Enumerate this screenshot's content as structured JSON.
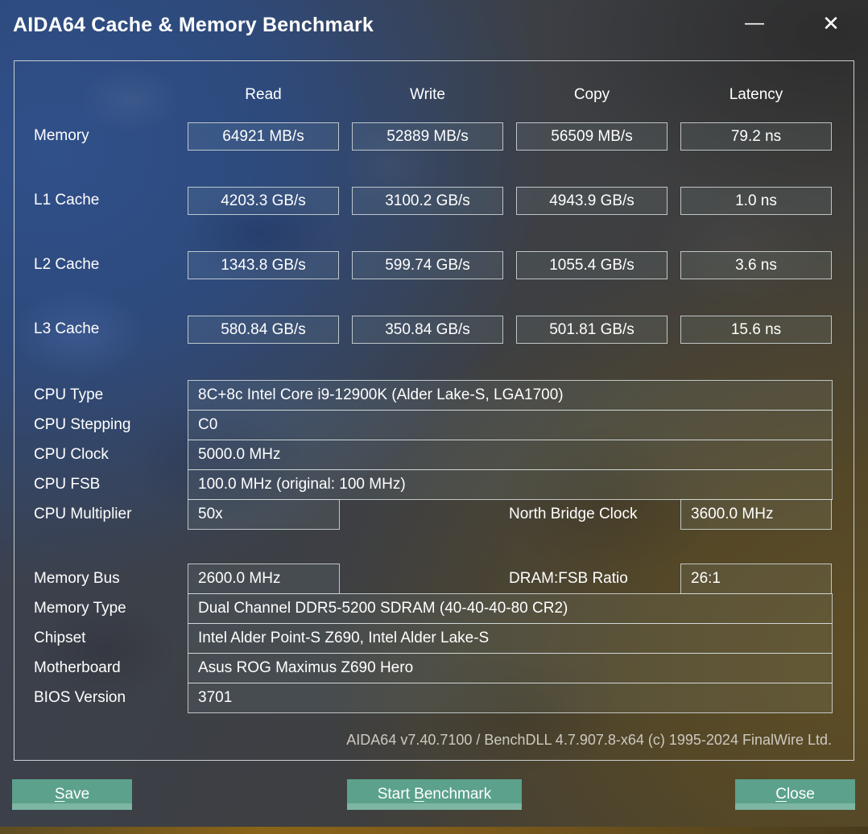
{
  "window": {
    "title": "AIDA64 Cache & Memory Benchmark",
    "minimize_icon": "—",
    "close_icon": "✕"
  },
  "benchmark": {
    "columns": [
      "Read",
      "Write",
      "Copy",
      "Latency"
    ],
    "rows": [
      {
        "label": "Memory",
        "values": [
          "64921 MB/s",
          "52889 MB/s",
          "56509 MB/s",
          "79.2 ns"
        ]
      },
      {
        "label": "L1 Cache",
        "values": [
          "4203.3 GB/s",
          "3100.2 GB/s",
          "4943.9 GB/s",
          "1.0 ns"
        ]
      },
      {
        "label": "L2 Cache",
        "values": [
          "1343.8 GB/s",
          "599.74 GB/s",
          "1055.4 GB/s",
          "3.6 ns"
        ]
      },
      {
        "label": "L3 Cache",
        "values": [
          "580.84 GB/s",
          "350.84 GB/s",
          "501.81 GB/s",
          "15.6 ns"
        ]
      }
    ]
  },
  "cpu": {
    "stack": [
      {
        "label": "CPU Type",
        "value": "8C+8c Intel Core i9-12900K  (Alder Lake-S, LGA1700)"
      },
      {
        "label": "CPU Stepping",
        "value": "C0"
      },
      {
        "label": "CPU Clock",
        "value": "5000.0 MHz"
      },
      {
        "label": "CPU FSB",
        "value": "100.0 MHz  (original: 100 MHz)"
      }
    ],
    "multiplier": {
      "label": "CPU Multiplier",
      "value": "50x",
      "bridge_label": "North Bridge Clock",
      "bridge_value": "3600.0 MHz"
    }
  },
  "memory": {
    "bus": {
      "label": "Memory Bus",
      "value": "2600.0 MHz",
      "ratio_label": "DRAM:FSB Ratio",
      "ratio_value": "26:1"
    },
    "stack": [
      {
        "label": "Memory Type",
        "value": "Dual Channel DDR5-5200 SDRAM  (40-40-40-80 CR2)"
      },
      {
        "label": "Chipset",
        "value": "Intel Alder Point-S Z690, Intel Alder Lake-S"
      },
      {
        "label": "Motherboard",
        "value": "Asus ROG Maximus Z690 Hero"
      },
      {
        "label": "BIOS Version",
        "value": "3701"
      }
    ]
  },
  "footer": {
    "text": "AIDA64 v7.40.7100 / BenchDLL 4.7.907.8-x64  (c) 1995-2024 FinalWire Ltd."
  },
  "buttons": {
    "save": {
      "pre": "",
      "key": "S",
      "post": "ave"
    },
    "start": {
      "pre": "Start ",
      "key": "B",
      "post": "enchmark"
    },
    "close": {
      "pre": "",
      "key": "C",
      "post": "lose"
    }
  },
  "colors": {
    "button": "#5ba18b",
    "button_bottom_edge": "#7db6a3",
    "panel_border": "#caced0",
    "bg_blue": "#2e4a7c",
    "bg_olive": "#554827",
    "bottom_strip": "#8a6418"
  }
}
